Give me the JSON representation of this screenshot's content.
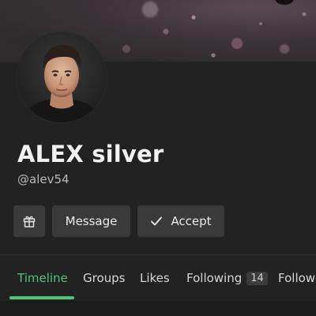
{
  "profile": {
    "name": "ALEX silver",
    "handle": "@alev54",
    "avatar_icon": "profile-photo"
  },
  "actions": {
    "gift_icon": "gift-icon",
    "message_label": "Message",
    "accept_label": "Accept",
    "accept_icon": "check-icon"
  },
  "tabs": [
    {
      "label": "Timeline",
      "active": true
    },
    {
      "label": "Groups",
      "active": false
    },
    {
      "label": "Likes",
      "active": false
    },
    {
      "label": "Following",
      "count": "14",
      "active": false
    },
    {
      "label": "Followe",
      "active": false
    }
  ],
  "colors": {
    "accent": "#4fc27a",
    "background": "#222222",
    "button": "#3a3a3a"
  }
}
